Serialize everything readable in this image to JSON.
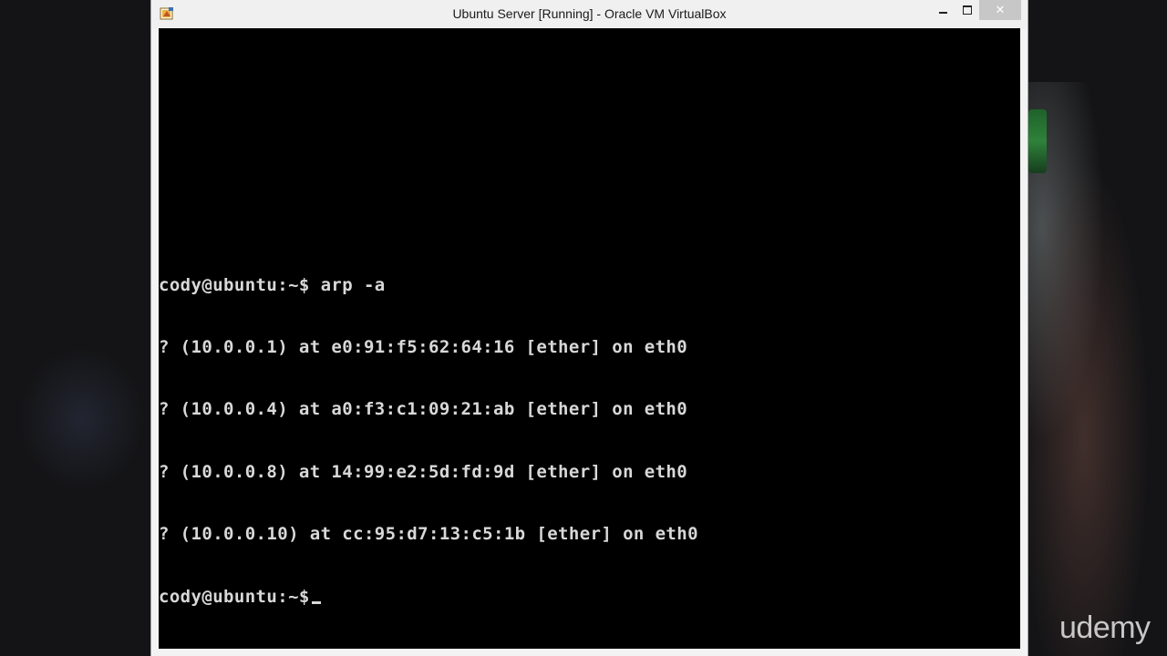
{
  "window": {
    "title": "Ubuntu Server [Running] - Oracle VM VirtualBox",
    "app_icon": "virtualbox-icon",
    "controls": {
      "minimize_icon": "minimize-icon",
      "maximize_icon": "maximize-icon",
      "close_label": "✕"
    }
  },
  "console": {
    "prompt_command": "cody@ubuntu:~$ arp -a",
    "arp_entries": [
      "? (10.0.0.1) at e0:91:f5:62:64:16 [ether] on eth0",
      "? (10.0.0.4) at a0:f3:c1:09:21:ab [ether] on eth0",
      "? (10.0.0.8) at 14:99:e2:5d:fd:9d [ether] on eth0",
      "? (10.0.0.10) at cc:95:d7:13:c5:1b [ether] on eth0"
    ],
    "current_prompt": "cody@ubuntu:~$"
  },
  "watermark": {
    "text": "udemy"
  },
  "colors": {
    "console_bg": "#000000",
    "console_text": "#d8d8d8",
    "titlebar_bg": "#f0f0f0",
    "close_button_bg": "#c7c7c7",
    "desktop_bg": "#141416"
  }
}
